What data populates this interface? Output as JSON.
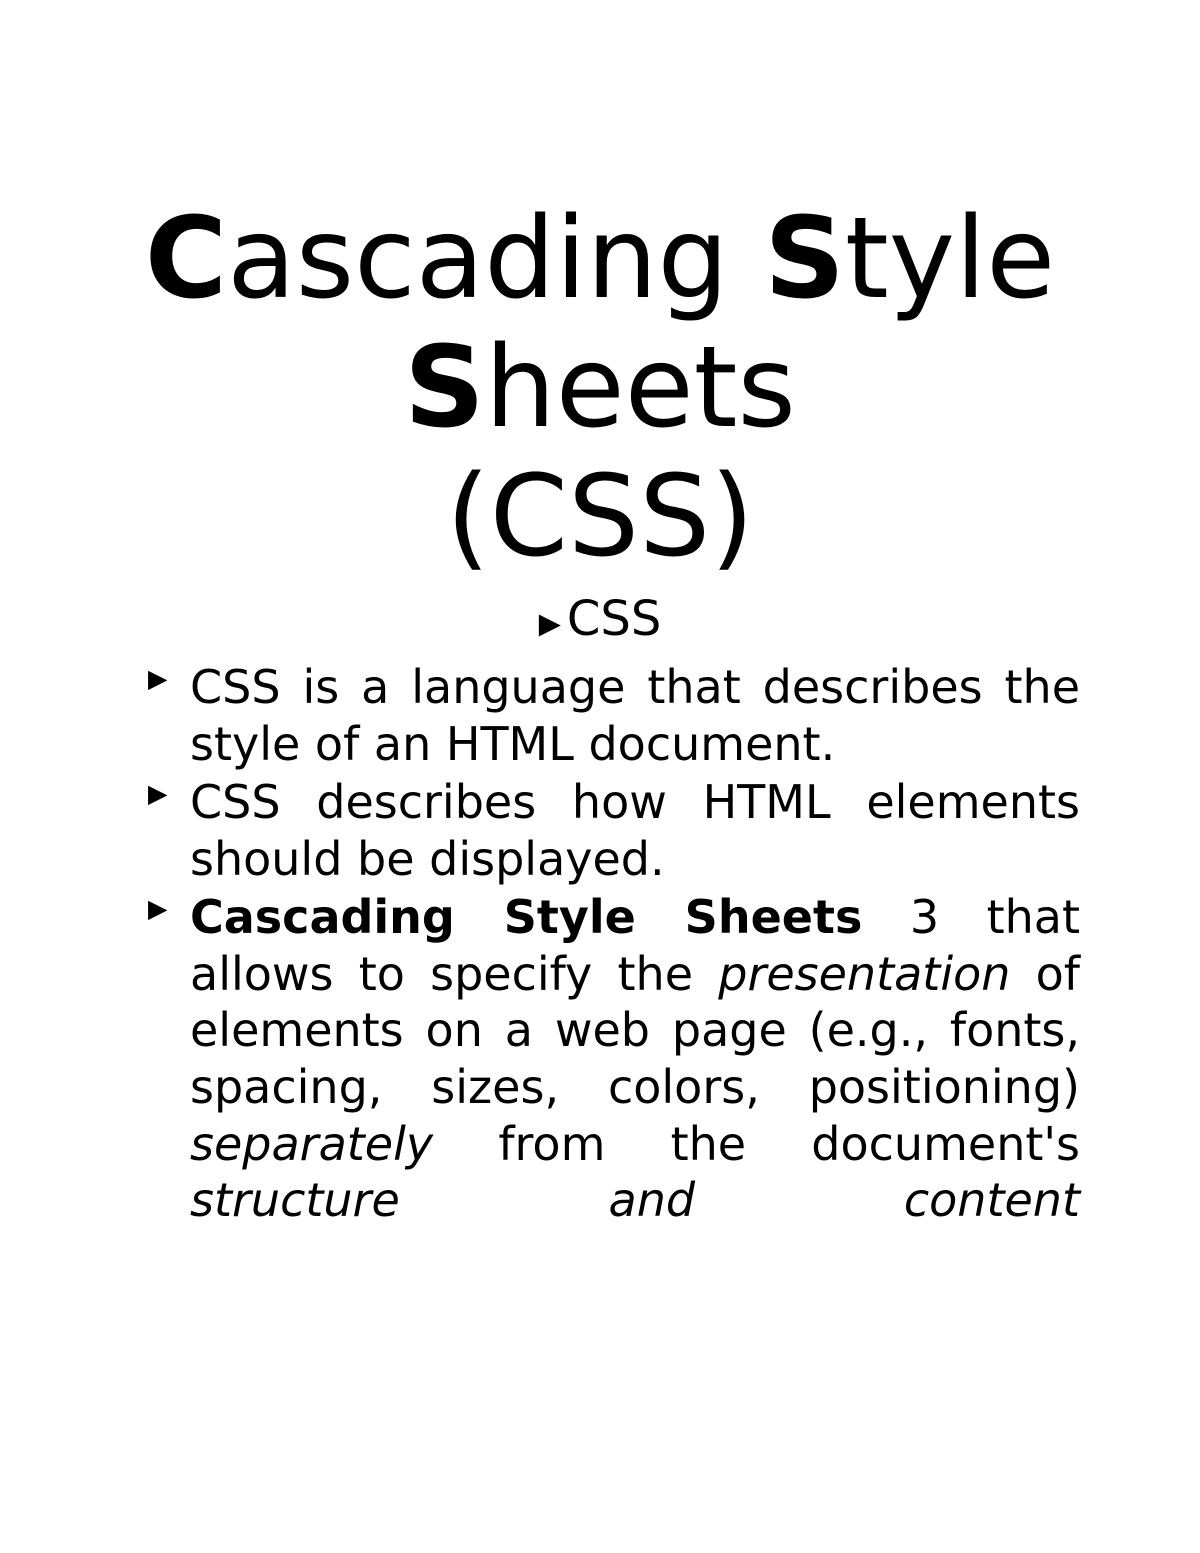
{
  "title": {
    "c1": "C",
    "r1": "ascading ",
    "c2": "S",
    "r2": "tyle",
    "c3": "S",
    "r3": "heets",
    "paren": "(CSS)"
  },
  "subhead": "CSS",
  "bullets": {
    "b1": "CSS is a language that describes the style of an HTML document.",
    "b2": "CSS describes how HTML elements should be displayed.",
    "b3": {
      "bold1": "Cascading Style Sheets",
      "t1": " 3  that allows to specify the ",
      "it1": "presentation",
      "t2": " of elements on a web page (e.g., fonts, spacing, sizes, colors, positioning) ",
      "it2": "separately",
      "t3": " from the document's ",
      "it3": "structure and content"
    }
  }
}
